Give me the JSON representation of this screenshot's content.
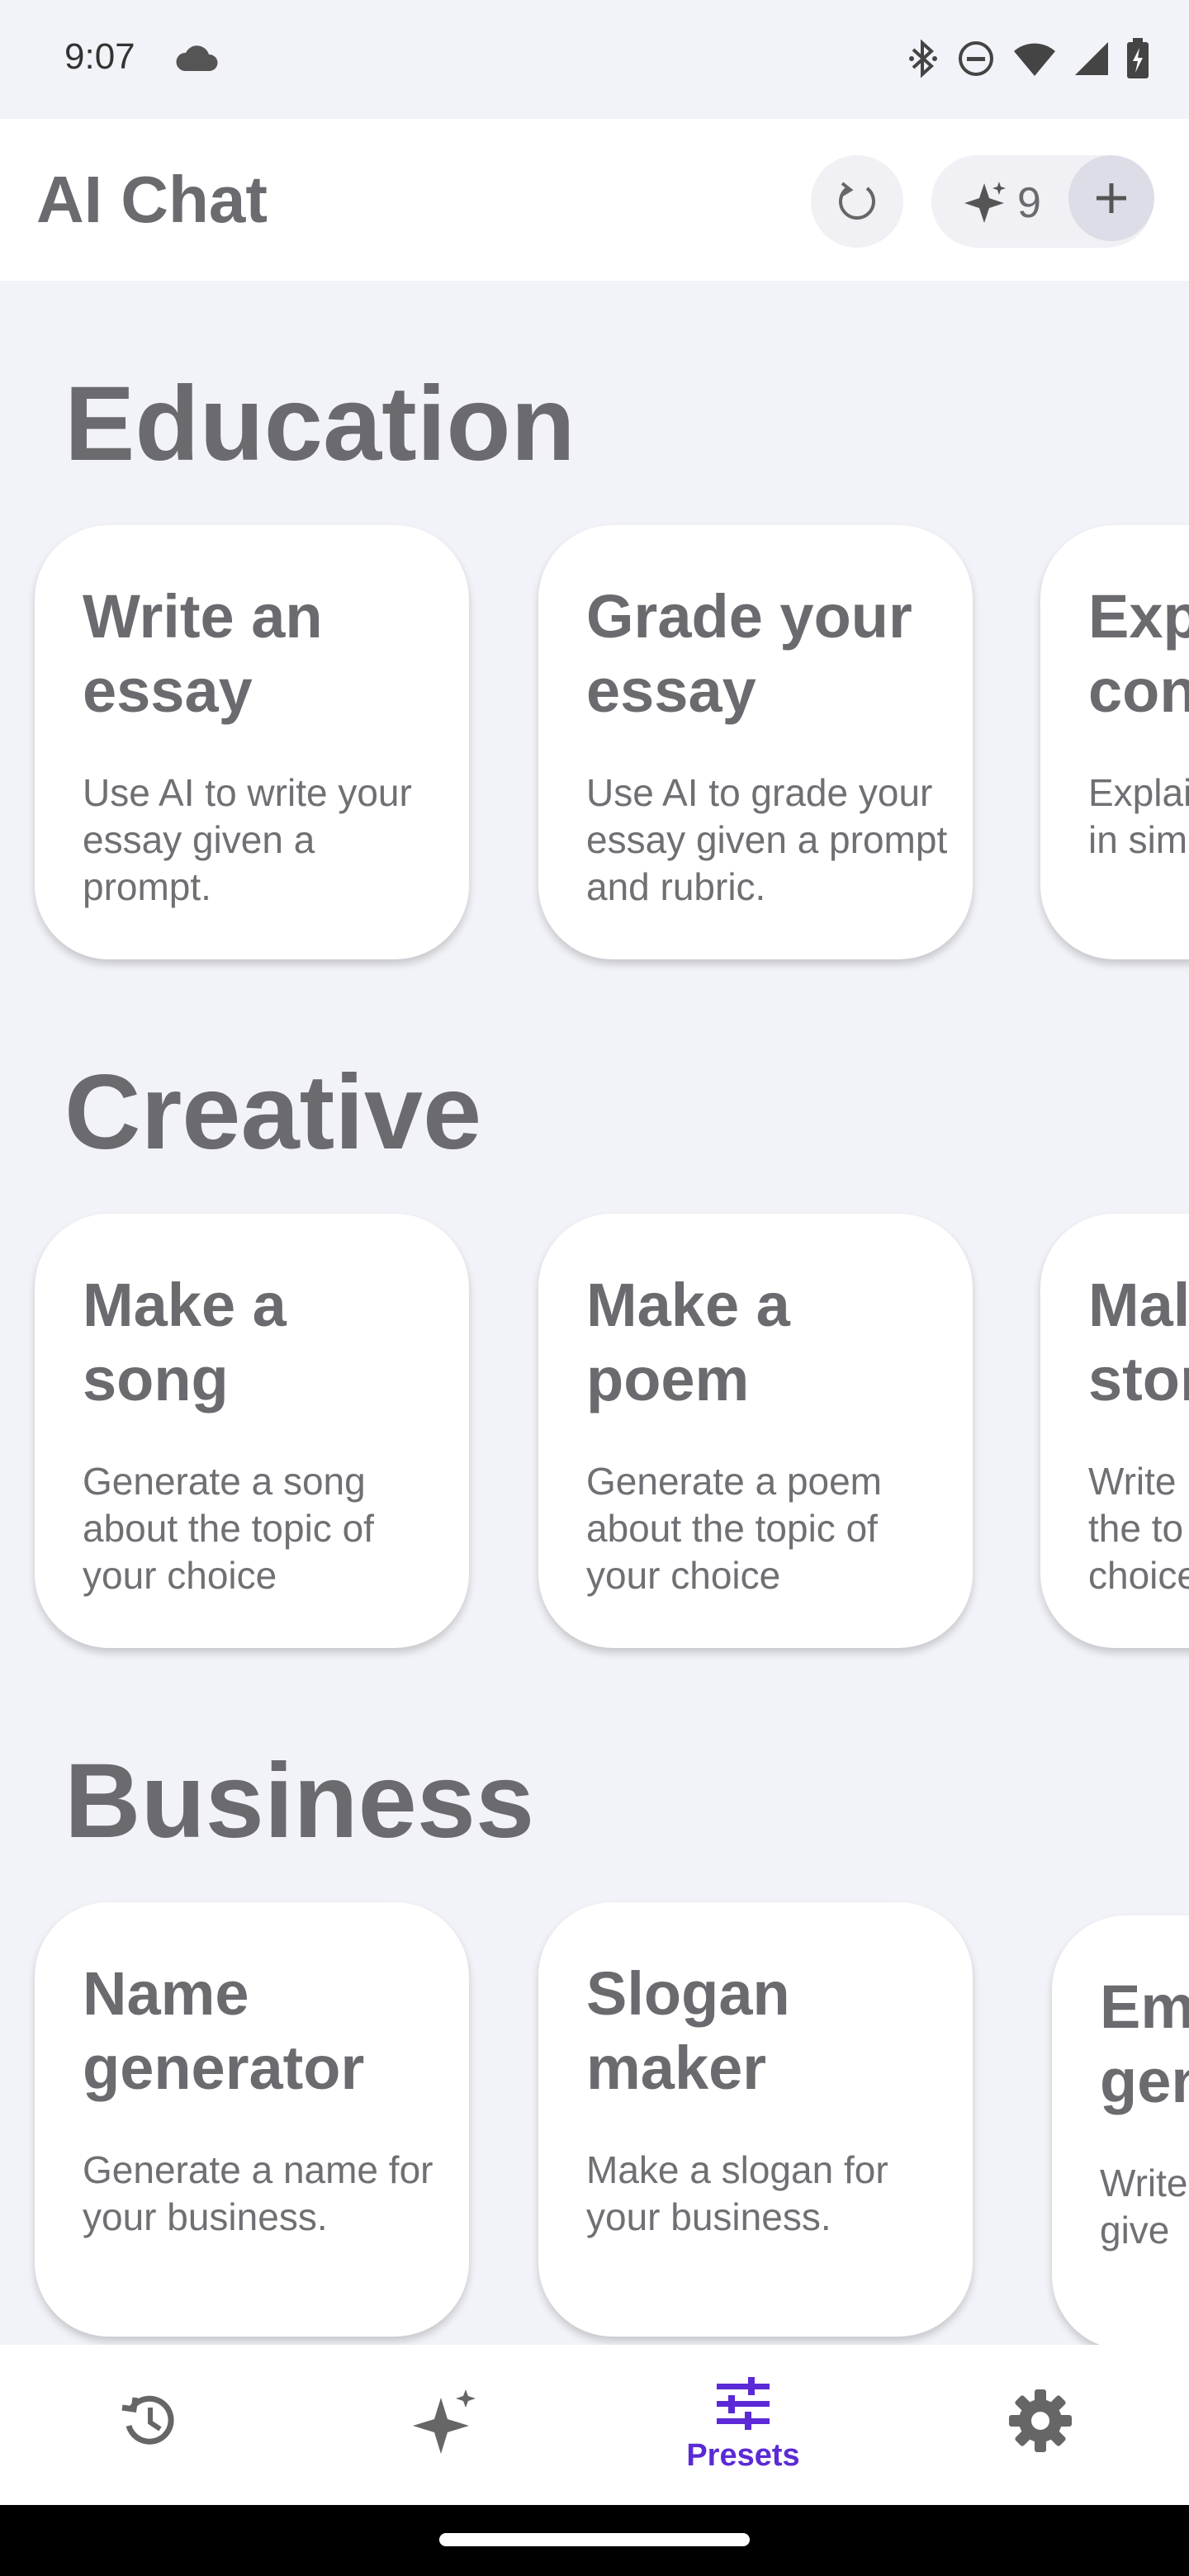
{
  "status_bar": {
    "time": "9:07",
    "icons": [
      "cloud-icon",
      "bluetooth-icon",
      "do-not-disturb-icon",
      "wifi-icon",
      "signal-icon",
      "battery-icon"
    ]
  },
  "app_bar": {
    "title": "AI Chat",
    "credits": "9",
    "icons": [
      "refresh-icon",
      "sparkle-icon",
      "plus-icon"
    ]
  },
  "sections": [
    {
      "title": "Education",
      "cards": [
        {
          "title": "Write an essay",
          "description": "Use AI to write your essay given a prompt."
        },
        {
          "title": "Grade your essay",
          "description": "Use AI to grade your essay given a prompt and rubric."
        },
        {
          "title": "Exp con",
          "description": "Explai in sim"
        }
      ]
    },
    {
      "title": "Creative",
      "cards": [
        {
          "title": "Make a song",
          "description": "Generate a song about the topic of your choice"
        },
        {
          "title": "Make a poem",
          "description": "Generate a poem about the topic of your choice"
        },
        {
          "title": "Mal stor",
          "description": "Write the to choice"
        }
      ]
    },
    {
      "title": "Business",
      "cards": [
        {
          "title": "Name generator",
          "description": "Generate a name for your business."
        },
        {
          "title": "Slogan maker",
          "description": "Make a slogan for your business."
        },
        {
          "title": "Em gen",
          "description": "Write a give"
        }
      ]
    }
  ],
  "bottom_nav": {
    "items": [
      {
        "icon": "history-icon",
        "label": ""
      },
      {
        "icon": "sparkle-icon",
        "label": ""
      },
      {
        "icon": "presets-icon",
        "label": "Presets",
        "active": true
      },
      {
        "icon": "settings-icon",
        "label": ""
      }
    ],
    "accent_color": "#5b2ad6"
  }
}
